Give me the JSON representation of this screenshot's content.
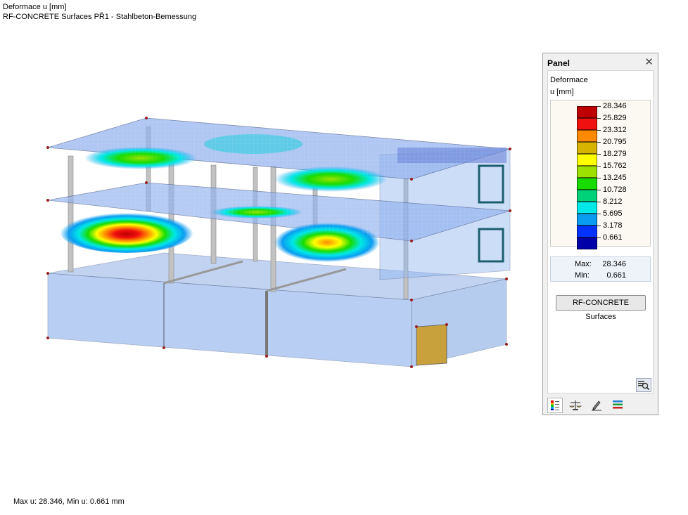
{
  "header": {
    "line1": "Deformace u [mm]",
    "line2": "RF-CONCRETE Surfaces PŘ1 - Stahlbeton-Bemessung"
  },
  "footer": {
    "info": "Max u: 28.346, Min u: 0.661 mm"
  },
  "panel": {
    "title": "Panel",
    "result_name": "Deformace",
    "unit": "u [mm]",
    "scale": [
      {
        "value": "28.346",
        "color": "#be0000"
      },
      {
        "value": "25.829",
        "color": "#f01010"
      },
      {
        "value": "23.312",
        "color": "#ff8a00"
      },
      {
        "value": "20.795",
        "color": "#d6b400"
      },
      {
        "value": "18.279",
        "color": "#ffff00"
      },
      {
        "value": "15.762",
        "color": "#9ee000"
      },
      {
        "value": "13.245",
        "color": "#18dc00"
      },
      {
        "value": "10.728",
        "color": "#00d27a"
      },
      {
        "value": "8.212",
        "color": "#00e8e8"
      },
      {
        "value": "5.695",
        "color": "#0a9cf0"
      },
      {
        "value": "3.178",
        "color": "#0032ff"
      },
      {
        "value": "0.661",
        "color": "#0000a8"
      }
    ],
    "max_label": "Max:",
    "max_value": "28.346",
    "min_label": "Min:",
    "min_value": "0.661",
    "button_label": "RF-CONCRETE Surfaces",
    "tabs": [
      "color-scale-icon",
      "balance-icon",
      "pencil-icon",
      "lines-icon"
    ]
  }
}
